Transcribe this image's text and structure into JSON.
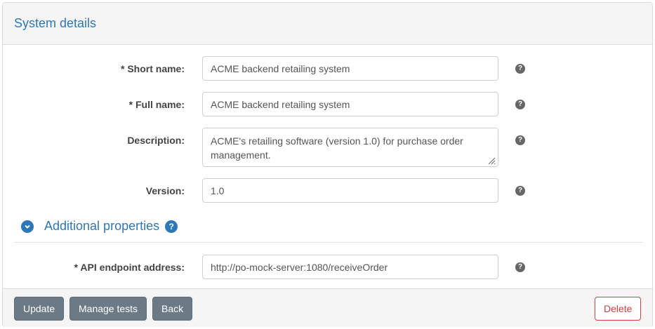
{
  "panel": {
    "title": "System details"
  },
  "fields": {
    "short_name": {
      "label": "* Short name:",
      "value": "ACME backend retailing system"
    },
    "full_name": {
      "label": "* Full name:",
      "value": "ACME backend retailing system"
    },
    "description": {
      "label": "Description:",
      "value": "ACME's retailing software (version 1.0) for purchase order management."
    },
    "version": {
      "label": "Version:",
      "value": "1.0"
    }
  },
  "additional": {
    "title": "Additional properties",
    "api_endpoint": {
      "label": "* API endpoint address:",
      "value": "http://po-mock-server:1080/receiveOrder"
    }
  },
  "help_glyph": "?",
  "buttons": {
    "update": "Update",
    "manage_tests": "Manage tests",
    "back": "Back",
    "delete": "Delete"
  },
  "icons": {
    "help": "help-icon",
    "chevron": "chevron-down-icon",
    "resize": "resize-grip-icon"
  },
  "colors": {
    "accent": "#2c78b8",
    "button_gray": "#6c7a85",
    "danger": "#d43f3f"
  }
}
